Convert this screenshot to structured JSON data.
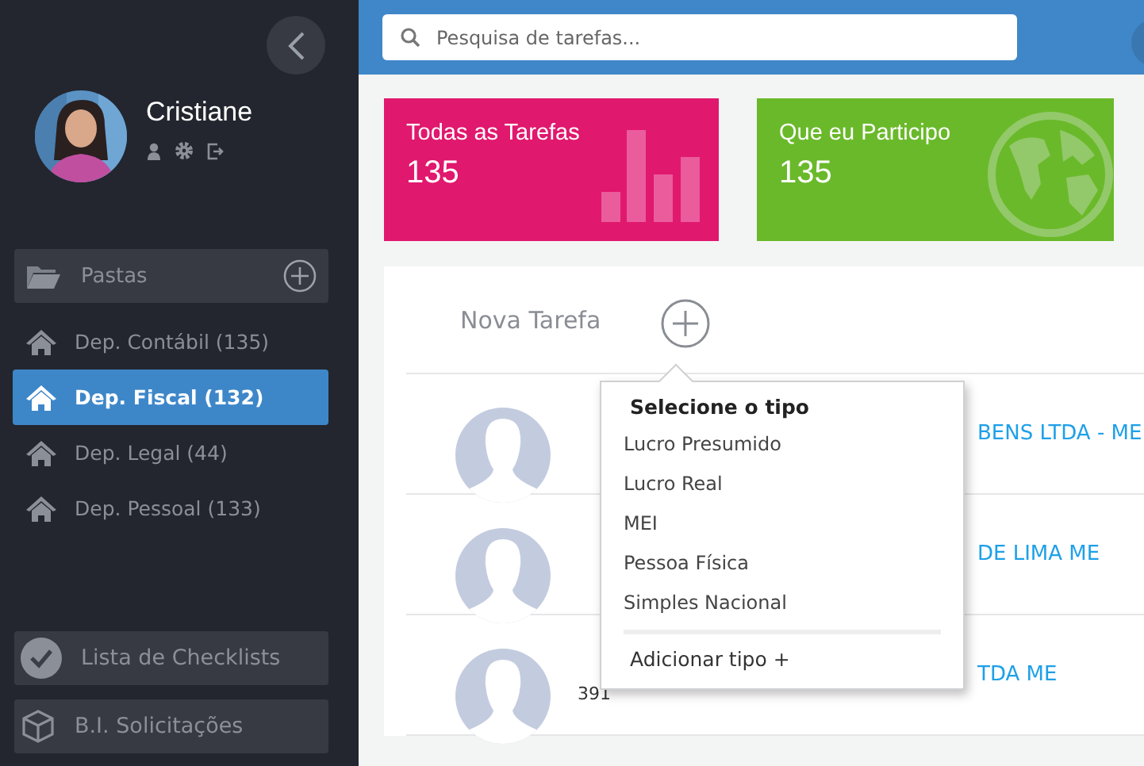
{
  "sidebar": {
    "user": {
      "name": "Cristiane"
    },
    "folders_header": {
      "label": "Pastas"
    },
    "items": [
      {
        "label": "Dep. Contábil (135)",
        "selected": false
      },
      {
        "label": "Dep. Fiscal (132)",
        "selected": true
      },
      {
        "label": "Dep. Legal (44)",
        "selected": false
      },
      {
        "label": "Dep. Pessoal (133)",
        "selected": false
      }
    ],
    "bottom_buttons": [
      {
        "label": "Lista de Checklists",
        "kind": "check"
      },
      {
        "label": "B.I. Solicitações",
        "kind": "cube"
      }
    ]
  },
  "search": {
    "placeholder": "Pesquisa de tarefas..."
  },
  "cards": [
    {
      "title": "Todas as Tarefas",
      "count": "135",
      "kind": "chart"
    },
    {
      "title": "Que eu Participo",
      "count": "135",
      "kind": "globe"
    }
  ],
  "new_task": {
    "label": "Nova Tarefa"
  },
  "rows": [
    {
      "name": "BENS LTDA - ME"
    },
    {
      "name": "DE LIMA ME"
    },
    {
      "name": "TDA ME",
      "number": "391"
    }
  ],
  "type_popup": {
    "title": "Selecione o tipo",
    "options": [
      "Lucro Presumido",
      "Lucro Real",
      "MEI",
      "Pessoa Física",
      "Simples Nacional"
    ],
    "add_label": "Adicionar tipo +"
  }
}
